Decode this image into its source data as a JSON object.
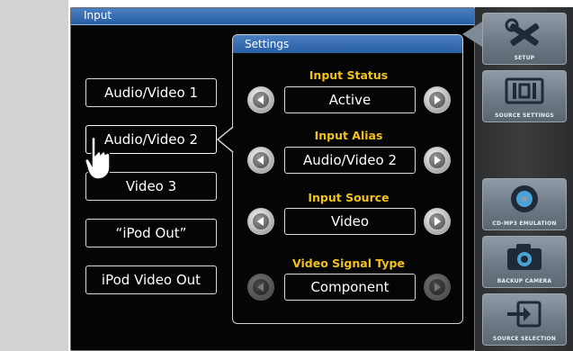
{
  "window": {
    "title": "Input"
  },
  "inputs": [
    {
      "label": "Audio/Video 1"
    },
    {
      "label": "Audio/Video 2"
    },
    {
      "label": "Video 3"
    },
    {
      "label": "“iPod Out”"
    },
    {
      "label": "iPod Video Out"
    }
  ],
  "settings": {
    "title": "Settings",
    "fields": [
      {
        "label": "Input Status",
        "value": "Active",
        "enabled": true
      },
      {
        "label": "Input Alias",
        "value": "Audio/Video 2",
        "enabled": true
      },
      {
        "label": "Input Source",
        "value": "Video",
        "enabled": true
      },
      {
        "label": "Video Signal Type",
        "value": "Component",
        "enabled": false
      }
    ]
  },
  "sidebar": [
    {
      "label": "SETUP",
      "icon": "setup-tools-icon"
    },
    {
      "label": "SOURCE SETTINGS",
      "icon": "source-settings-icon"
    },
    {
      "label": "CD-MP3 EMULATION",
      "icon": "cd-disc-icon"
    },
    {
      "label": "BACKUP CAMERA",
      "icon": "camera-icon"
    },
    {
      "label": "SOURCE SELECTION",
      "icon": "source-selection-icon"
    }
  ],
  "colors": {
    "title_bar": "#3b6fb3",
    "label_yellow": "#f2c21a"
  }
}
